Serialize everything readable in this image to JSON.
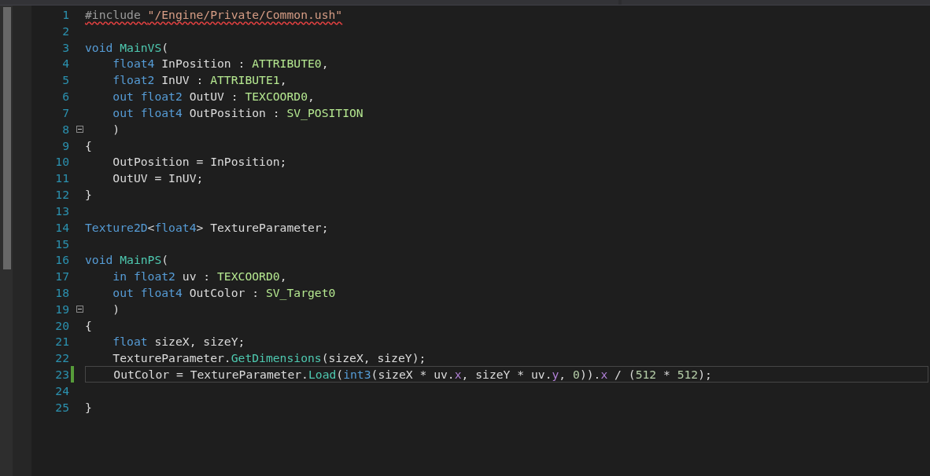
{
  "editor": {
    "lines": [
      {
        "number": "1",
        "error": true,
        "tokens": [
          {
            "t": "#include ",
            "kind": "directive"
          },
          {
            "t": "\"/Engine/Private/Common.ush\"",
            "kind": "string"
          }
        ]
      },
      {
        "number": "2"
      },
      {
        "number": "3",
        "tokens": [
          {
            "t": "void ",
            "kind": "keyword"
          },
          {
            "t": "MainVS",
            "kind": "function"
          },
          {
            "t": "("
          }
        ]
      },
      {
        "number": "4",
        "tokens": [
          {
            "t": "    float4",
            "kind": "keyword"
          },
          {
            "t": " InPosition : "
          },
          {
            "t": "ATTRIBUTE0",
            "kind": "semantic"
          },
          {
            "t": ","
          }
        ]
      },
      {
        "number": "5",
        "tokens": [
          {
            "t": "    float2",
            "kind": "keyword"
          },
          {
            "t": " InUV : "
          },
          {
            "t": "ATTRIBUTE1",
            "kind": "semantic"
          },
          {
            "t": ","
          }
        ]
      },
      {
        "number": "6",
        "tokens": [
          {
            "t": "    out float2",
            "kind": "keyword"
          },
          {
            "t": " OutUV : "
          },
          {
            "t": "TEXCOORD0",
            "kind": "semantic"
          },
          {
            "t": ","
          }
        ]
      },
      {
        "number": "7",
        "tokens": [
          {
            "t": "    out float4",
            "kind": "keyword"
          },
          {
            "t": " OutPosition : "
          },
          {
            "t": "SV_POSITION",
            "kind": "semantic"
          }
        ]
      },
      {
        "number": "8",
        "fold": {
          "expanded": true
        },
        "tokens": [
          {
            "t": "    )"
          }
        ]
      },
      {
        "number": "9",
        "tokens": [
          {
            "t": "{"
          }
        ]
      },
      {
        "number": "10",
        "tokens": [
          {
            "t": "    OutPosition = InPosition;"
          }
        ]
      },
      {
        "number": "11",
        "tokens": [
          {
            "t": "    OutUV = InUV;"
          }
        ]
      },
      {
        "number": "12",
        "tokens": [
          {
            "t": "}"
          }
        ]
      },
      {
        "number": "13"
      },
      {
        "number": "14",
        "tokens": [
          {
            "t": "Texture2D",
            "kind": "keyword"
          },
          {
            "t": "<"
          },
          {
            "t": "float4",
            "kind": "keyword"
          },
          {
            "t": "> TextureParameter;"
          }
        ]
      },
      {
        "number": "15"
      },
      {
        "number": "16",
        "tokens": [
          {
            "t": "void ",
            "kind": "keyword"
          },
          {
            "t": "MainPS",
            "kind": "function"
          },
          {
            "t": "("
          }
        ]
      },
      {
        "number": "17",
        "tokens": [
          {
            "t": "    in float2",
            "kind": "keyword"
          },
          {
            "t": " uv : "
          },
          {
            "t": "TEXCOORD0",
            "kind": "semantic"
          },
          {
            "t": ","
          }
        ]
      },
      {
        "number": "18",
        "tokens": [
          {
            "t": "    out float4",
            "kind": "keyword"
          },
          {
            "t": " OutColor : "
          },
          {
            "t": "SV_Target0",
            "kind": "semantic"
          }
        ]
      },
      {
        "number": "19",
        "fold": {
          "expanded": true
        },
        "tokens": [
          {
            "t": "    )"
          }
        ]
      },
      {
        "number": "20",
        "tokens": [
          {
            "t": "{"
          }
        ]
      },
      {
        "number": "21",
        "tokens": [
          {
            "t": "    float",
            "kind": "keyword"
          },
          {
            "t": " sizeX, sizeY;"
          }
        ]
      },
      {
        "number": "22",
        "tokens": [
          {
            "t": "    TextureParameter."
          },
          {
            "t": "GetDimensions",
            "kind": "function"
          },
          {
            "t": "(sizeX, sizeY);"
          }
        ]
      },
      {
        "number": "23",
        "current": true,
        "changed": true,
        "tokens": [
          {
            "t": "    OutColor = TextureParameter."
          },
          {
            "t": "Load",
            "kind": "function"
          },
          {
            "t": "("
          },
          {
            "t": "int3",
            "kind": "keyword"
          },
          {
            "t": "(sizeX * uv."
          },
          {
            "t": "x",
            "kind": "swizzle"
          },
          {
            "t": ", sizeY * uv."
          },
          {
            "t": "y",
            "kind": "swizzle"
          },
          {
            "t": ", "
          },
          {
            "t": "0",
            "kind": "number"
          },
          {
            "t": "))."
          },
          {
            "t": "x",
            "kind": "swizzle"
          },
          {
            "t": " / ("
          },
          {
            "t": "512",
            "kind": "number"
          },
          {
            "t": " * "
          },
          {
            "t": "512",
            "kind": "number"
          },
          {
            "t": ");"
          }
        ]
      },
      {
        "number": "24"
      },
      {
        "number": "25",
        "tokens": [
          {
            "t": "}"
          }
        ]
      }
    ]
  }
}
